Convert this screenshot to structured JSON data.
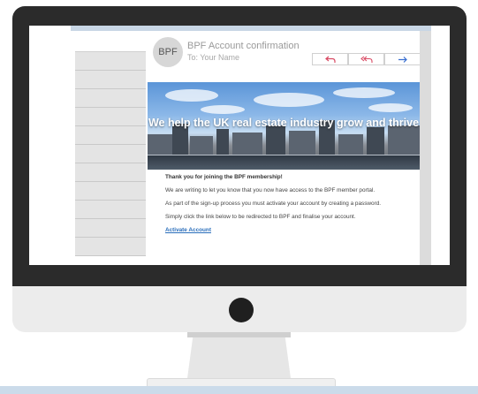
{
  "email": {
    "avatar_initials": "BPF",
    "subject": "BPF Account confirmation",
    "to_line": "To: Your Name",
    "actions": {
      "reply_icon": "reply-icon",
      "reply_all_icon": "reply-all-icon",
      "forward_icon": "forward-icon"
    },
    "hero_text": "We help the UK real estate industry grow and thrive",
    "body": {
      "greeting": "Thank you for joining the BPF membership!",
      "paragraph_1": "We are writing to let you know that you now have access to the BPF member portal.",
      "paragraph_2": "As part of the sign-up process you must activate your account by creating a password.",
      "paragraph_3": "Simply click the link below to be redirected to BPF and finalise your account.",
      "link_label": "Activate Account"
    }
  },
  "colors": {
    "reply_accent": "#d94a63",
    "forward_accent": "#3a6fd0",
    "link": "#2a6ebb",
    "bezel": "#2b2b2b"
  }
}
